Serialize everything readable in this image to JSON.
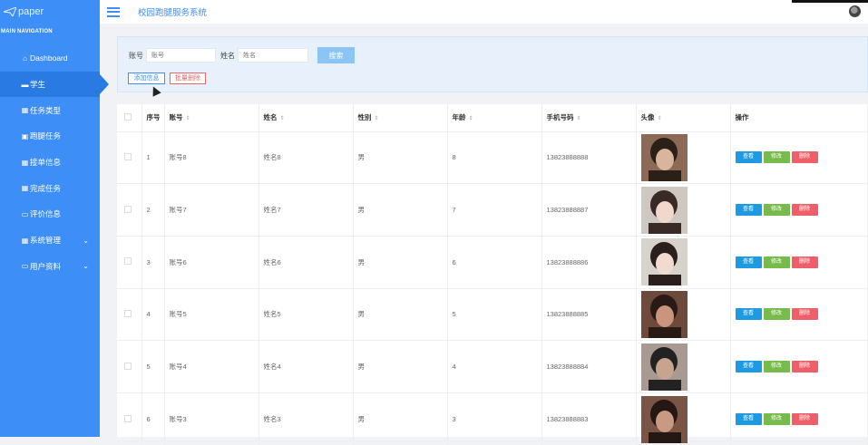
{
  "app": {
    "logo_text": "paper",
    "title": "校园跑腿服务系统"
  },
  "sidebar": {
    "heading": "MAIN NAVIGATION",
    "items": [
      {
        "icon": "house-icon",
        "glyph": "⌂",
        "label": "Dashboard"
      },
      {
        "icon": "monitor-icon",
        "glyph": "▬",
        "label": "学生",
        "active": true
      },
      {
        "icon": "grid-icon",
        "glyph": "▦",
        "label": "任务类型"
      },
      {
        "icon": "box-icon",
        "glyph": "▣",
        "label": "跑腿任务"
      },
      {
        "icon": "grid-icon",
        "glyph": "▦",
        "label": "接单信息"
      },
      {
        "icon": "grid-icon",
        "glyph": "▦",
        "label": "完成任务"
      },
      {
        "icon": "lock-icon",
        "glyph": "▭",
        "label": "评价信息"
      },
      {
        "icon": "grid-icon",
        "glyph": "▦",
        "label": "系统管理",
        "expandable": true
      },
      {
        "icon": "folder-icon",
        "glyph": "▭",
        "label": "用户资料",
        "expandable": true
      }
    ]
  },
  "search": {
    "account_label": "账号",
    "account_placeholder": "账号",
    "name_label": "姓名",
    "name_placeholder": "姓名",
    "search_button": "搜索",
    "add_button": "添加信息",
    "batch_delete_button": "批量删除"
  },
  "table": {
    "columns": [
      "序号",
      "账号",
      "姓名",
      "性别",
      "年龄",
      "手机号码",
      "头像",
      "操作"
    ],
    "action_labels": {
      "view": "查看",
      "edit": "修改",
      "delete": "删除"
    },
    "rows": [
      {
        "index": "1",
        "account": "账号8",
        "name": "姓名8",
        "gender": "男",
        "age": "8",
        "phone": "13823888888"
      },
      {
        "index": "2",
        "account": "账号7",
        "name": "姓名7",
        "gender": "男",
        "age": "7",
        "phone": "13823888887"
      },
      {
        "index": "3",
        "account": "账号6",
        "name": "姓名6",
        "gender": "男",
        "age": "6",
        "phone": "13823888886"
      },
      {
        "index": "4",
        "account": "账号5",
        "name": "姓名5",
        "gender": "男",
        "age": "5",
        "phone": "13823888885"
      },
      {
        "index": "5",
        "account": "账号4",
        "name": "姓名4",
        "gender": "男",
        "age": "4",
        "phone": "13823888884"
      },
      {
        "index": "6",
        "account": "账号3",
        "name": "姓名3",
        "gender": "男",
        "age": "3",
        "phone": "13823888883"
      }
    ]
  }
}
